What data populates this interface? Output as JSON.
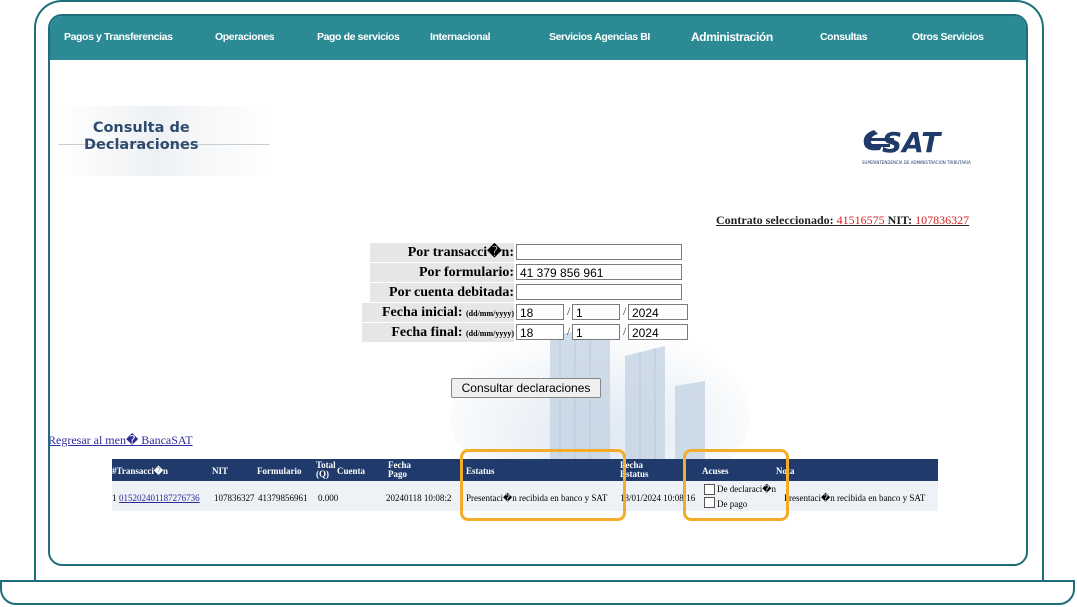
{
  "nav": {
    "items": [
      "Pagos y Transferencias",
      "Operaciones",
      "Pago de servicios",
      "Internacional",
      "Servicios Agencias BI",
      "Administración",
      "Consultas",
      "Otros Servicios"
    ]
  },
  "header": {
    "title_line1": "Consulta de",
    "title_line2": "Declaraciones",
    "logo_text": "SAT",
    "logo_subtext": "Superintendencia de Administración Tributaria"
  },
  "contrato": {
    "label": "Contrato seleccionado:",
    "contract": "41516575",
    "nit_label": "NIT:",
    "nit": "107836327"
  },
  "form": {
    "transaccion_label": "Por transacci�n:",
    "transaccion_value": "",
    "formulario_label": "Por formulario:",
    "formulario_value": "41 379 856 961",
    "cuenta_label": "Por cuenta debitada:",
    "cuenta_value": "",
    "fecha_inicial_label": "Fecha inicial:",
    "fecha_final_label": "Fecha final:",
    "date_format": "(dd/mm/yyyy)",
    "fecha_inicial": {
      "day": "18",
      "month": "1",
      "year": "2024"
    },
    "fecha_final": {
      "day": "18",
      "month": "1",
      "year": "2024"
    },
    "submit_label": "Consultar declaraciones"
  },
  "back_link": "Regresar al men� BancaSAT",
  "table": {
    "headers": {
      "transaccion": "#Transacci�n",
      "nit": "NIT",
      "formulario": "Formulario",
      "total_line1": "Total",
      "total_line2": "(Q)",
      "cuenta": "Cuenta",
      "fecha_pago_line1": "Fecha",
      "fecha_pago_line2": "Pago",
      "estatus": "Estatus",
      "fecha_estatus_line1": "Fecha",
      "fecha_estatus_line2": "Estatus",
      "acuses": "Acuses",
      "nota": "Nota"
    },
    "rows": [
      {
        "index": "1",
        "transaccion": "015202401187276736",
        "nit": "107836327",
        "formulario": "41379856961",
        "total": "0.000",
        "cuenta": "",
        "fecha_pago": "20240118 10:08:2",
        "estatus": "Presentaci�n recibida en banco y SAT",
        "fecha_estatus": "18/01/2024 10:08:16",
        "acuse_declaracion": "De declaraci�n",
        "acuse_pago": "De pago",
        "nota": "Presentaci�n recibida en banco y SAT"
      }
    ]
  },
  "colors": {
    "navbar": "#2b8a93",
    "frame": "#1d6e7a",
    "table_header": "#1f3a6b",
    "highlight": "#f4ad2a",
    "contract_red": "#d42020"
  }
}
